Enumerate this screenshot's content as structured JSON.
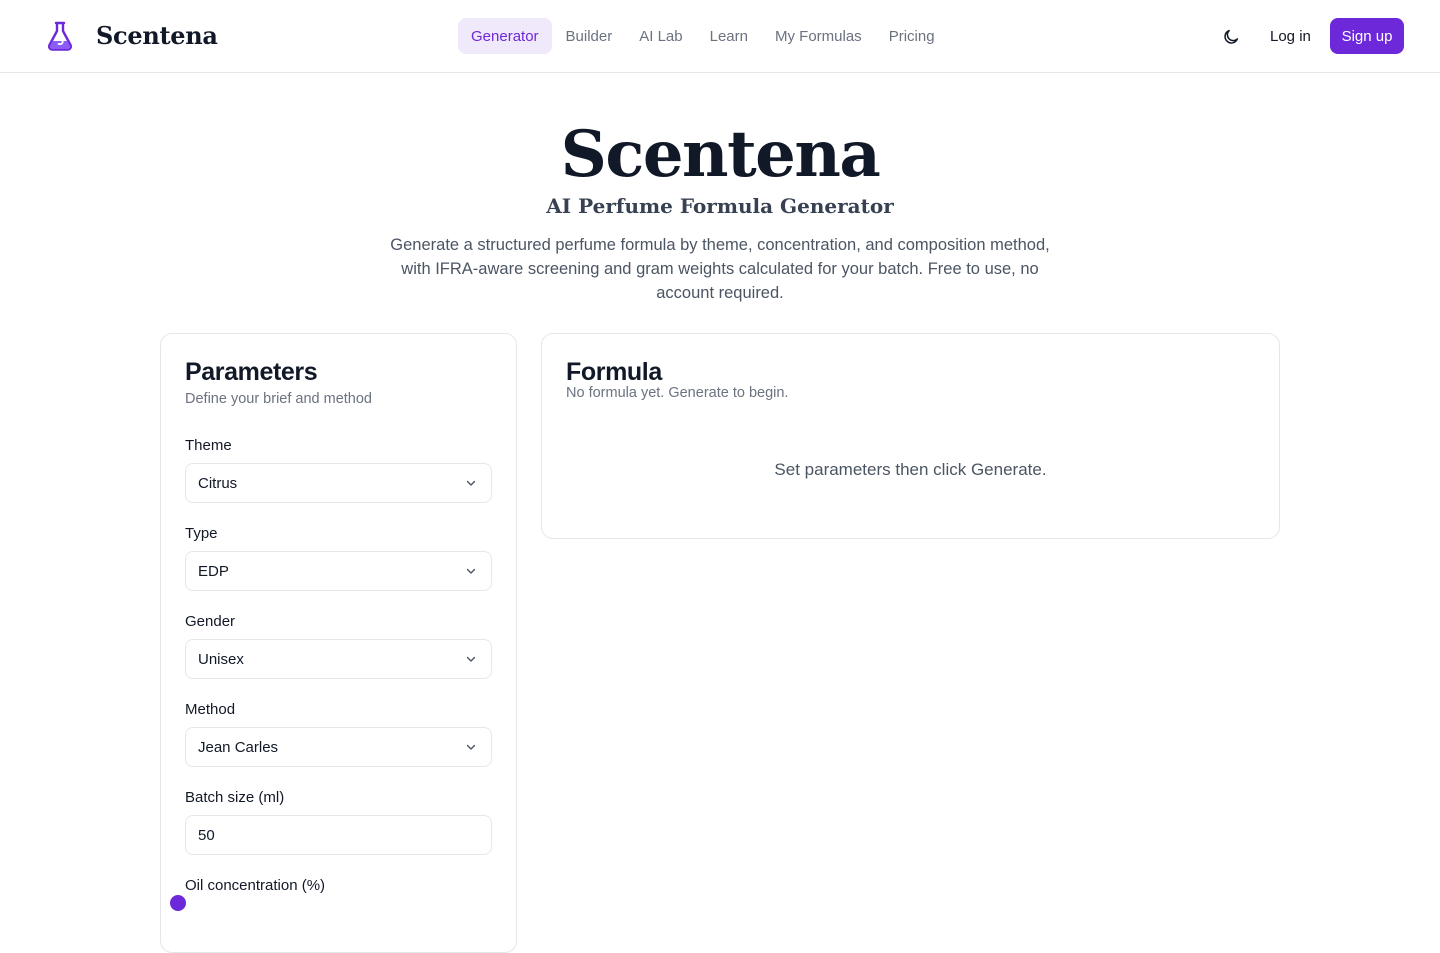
{
  "brand": {
    "name": "Scentena",
    "icon": "flask-icon"
  },
  "nav": {
    "items": [
      {
        "label": "Generator",
        "active": true
      },
      {
        "label": "Builder",
        "active": false
      },
      {
        "label": "AI Lab",
        "active": false
      },
      {
        "label": "Learn",
        "active": false
      },
      {
        "label": "My Formulas",
        "active": false
      },
      {
        "label": "Pricing",
        "active": false
      }
    ]
  },
  "header": {
    "theme_icon": "moon-icon",
    "login_label": "Log in",
    "signup_label": "Sign up"
  },
  "hero": {
    "title": "Scentena",
    "subtitle": "AI Perfume Formula Generator",
    "description": "Generate a structured perfume formula by theme, concentration, and composition method, with IFRA-aware screening and gram weights calculated for your batch. Free to use, no account required."
  },
  "parameters": {
    "title": "Parameters",
    "subtitle": "Define your brief and method",
    "fields": {
      "theme": {
        "label": "Theme",
        "value": "Citrus"
      },
      "type": {
        "label": "Type",
        "value": "EDP"
      },
      "gender": {
        "label": "Gender",
        "value": "Unisex"
      },
      "method": {
        "label": "Method",
        "value": "Jean Carles"
      },
      "batch": {
        "label": "Batch size (ml)",
        "value": "50"
      },
      "oil": {
        "label": "Oil concentration (%)"
      }
    }
  },
  "formula": {
    "title": "Formula",
    "subtitle": "No formula yet. Generate to begin.",
    "empty_message": "Set parameters then click Generate."
  },
  "colors": {
    "accent": "#6d28d9",
    "accent_soft": "#f0e9fb",
    "border": "#e5e7eb",
    "muted_text": "#6b7280"
  }
}
